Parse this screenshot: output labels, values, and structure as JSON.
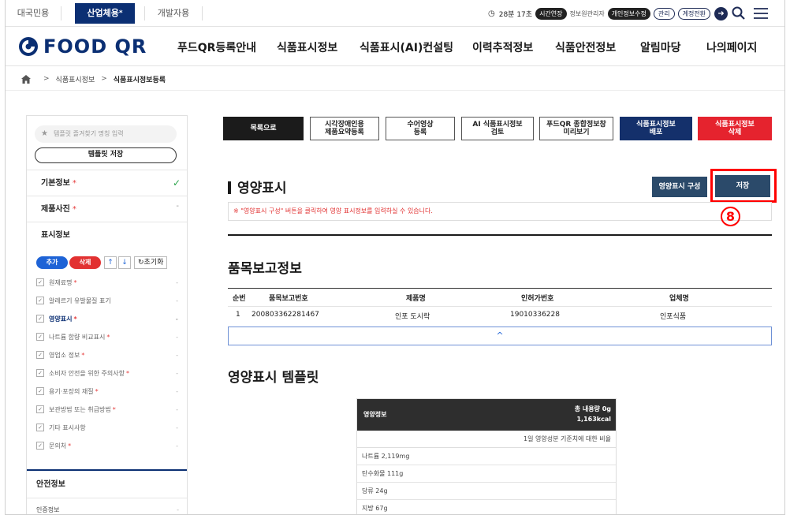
{
  "topbar": {
    "tabs": [
      {
        "label": "대국민용"
      },
      {
        "label": "산업체용",
        "star": "*"
      },
      {
        "label": "개발자용"
      }
    ],
    "session_time": "28분 17초",
    "extend_label": "시간연장",
    "manager_label": "정보원관리자",
    "edit_info_label": "개인정보수정",
    "manage_label": "관리",
    "switch_account_label": "계정전환"
  },
  "header": {
    "logo_text": "FOOD QR",
    "nav": [
      "푸드QR등록안내",
      "식품표시정보",
      "식품표시(AI)컨설팅",
      "이력추적정보",
      "식품안전정보",
      "알림마당",
      "나의페이지"
    ]
  },
  "breadcrumb": {
    "sep": ">",
    "items": [
      "식품표시정보",
      "식품표시정보등록"
    ]
  },
  "sidebar": {
    "search_placeholder": "템플릿 즐겨찾기 명칭 입력",
    "template_save": "템플릿 저장",
    "sections": {
      "basic": {
        "label": "기본정보",
        "req": "*",
        "mark": "✓"
      },
      "photo": {
        "label": "제품사진",
        "req": "*",
        "mark": "-"
      },
      "display": {
        "label": "표시정보"
      }
    },
    "buttons": {
      "add": "추가",
      "delete": "삭제",
      "up": "↑",
      "down": "↓",
      "reset": "초기화"
    },
    "items": [
      {
        "label": "원재료명",
        "req": "*"
      },
      {
        "label": "알레르기 유발물질 표기",
        "req": ""
      },
      {
        "label": "영양표시",
        "req": "*"
      },
      {
        "label": "나트륨 함량 비교표시",
        "req": "*"
      },
      {
        "label": "영업소 정보",
        "req": "*"
      },
      {
        "label": "소비자 안전을 위한 주의사항",
        "req": "*"
      },
      {
        "label": "용기·포장의 재질",
        "req": "*"
      },
      {
        "label": "보관방법 또는 취급방법",
        "req": "*"
      },
      {
        "label": "기타 표시사항",
        "req": ""
      },
      {
        "label": "문의처",
        "req": "*"
      }
    ],
    "dash": "-",
    "check": "✓",
    "safety": "안전정보",
    "cert": "인증정보"
  },
  "actions": {
    "list": "목록으로",
    "summary": "시각장애인용\n제품요약등록",
    "sign": "수어영상\n등록",
    "ai_review": "AI 식품표시정보\n검토",
    "preview": "푸드QR 종합정보창\n미리보기",
    "deploy": "식품표시정보\n배포",
    "delete": "식품표시정보\n삭제"
  },
  "nutrition": {
    "title": "영양표시",
    "compose_button": "영양표시 구성",
    "save_button": "저장",
    "step_marker": "8",
    "notice": "※ \"영양표시 구성\" 버튼을 클릭하여 영양 표시정보를 입력하실 수 있습니다."
  },
  "report": {
    "title": "품목보고정보",
    "columns": [
      "순번",
      "품목보고번호",
      "제품명",
      "인허가번호",
      "업체명"
    ],
    "rows": [
      [
        "1",
        "200803362281467",
        "인포 도시락",
        "19010336228",
        "인포식품"
      ]
    ],
    "collapse_icon": "^"
  },
  "template": {
    "title": "영양표시 템플릿",
    "label": "영양정보",
    "total": "총 내용량 0g",
    "kcal": "1,163kcal",
    "daily": "1일 영양성분 기준치에 대한 비율",
    "rows": [
      "나트륨 2,119mg",
      "탄수화물 111g",
      "당류 24g",
      "지방 67g"
    ]
  }
}
